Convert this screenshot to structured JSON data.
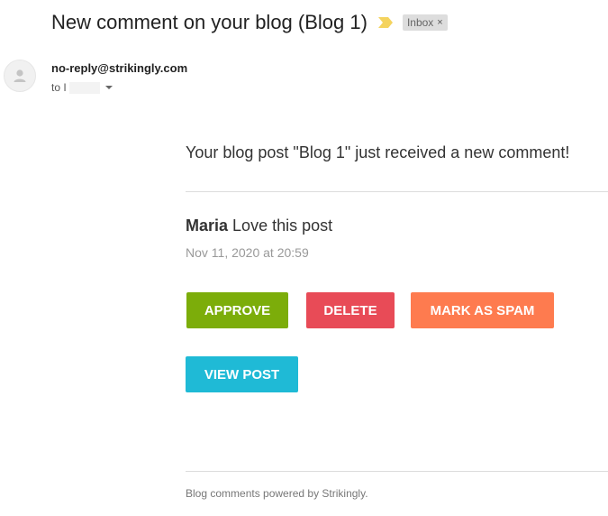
{
  "header": {
    "subject": "New comment on your blog (Blog 1)",
    "label": "Inbox",
    "label_remove": "×"
  },
  "sender": {
    "email": "no-reply@strikingly.com",
    "to_prefix": "to I"
  },
  "body": {
    "intro": "Your blog post \"Blog 1\" just received a new comment!",
    "comment_author": "Maria",
    "comment_text": "Love this post",
    "timestamp": "Nov 11, 2020 at 20:59"
  },
  "buttons": {
    "approve": "APPROVE",
    "delete": "DELETE",
    "spam": "MARK AS SPAM",
    "view_post": "VIEW POST"
  },
  "footer": {
    "text": "Blog comments powered by Strikingly."
  },
  "colors": {
    "approve": "#7cad0a",
    "delete": "#e84b57",
    "spam": "#fe7b4f",
    "view_post": "#1fbad6",
    "importance_marker": "#f4d35e"
  }
}
